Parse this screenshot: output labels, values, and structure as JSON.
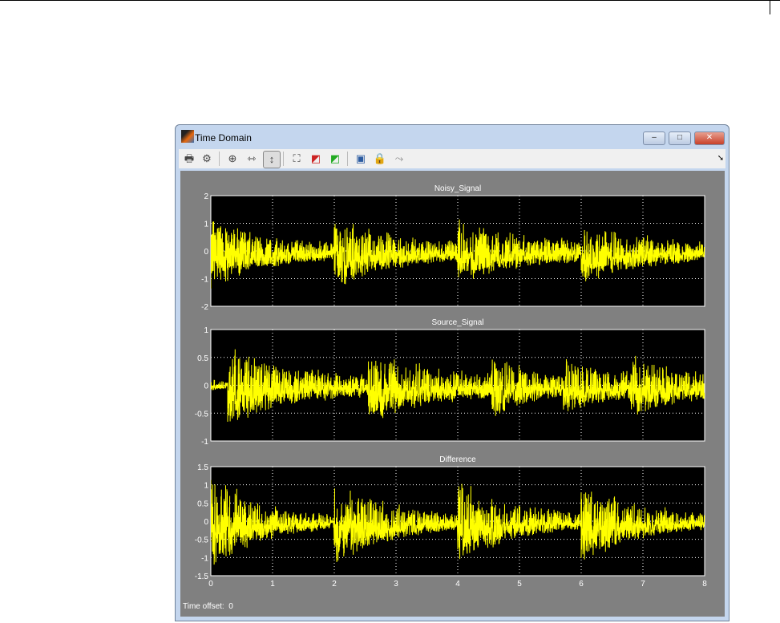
{
  "window": {
    "title": "Time Domain",
    "minimize": "–",
    "maximize": "□",
    "close": "✕"
  },
  "toolbar": {
    "icons": [
      "print-icon",
      "parameters-gear-icon",
      "zoom-in-icon",
      "zoom-x-icon",
      "zoom-y-icon",
      "autoscale-icon",
      "save-axes-icon",
      "restore-axes-icon",
      "highlight-block-icon",
      "lock-icon",
      "signal-selector-icon"
    ],
    "arrow": "➘"
  },
  "footer": {
    "time_offset_label": "Time offset:",
    "time_offset_value": "0"
  },
  "colors": {
    "trace": "#ffff00",
    "axes_bg": "#000000",
    "figure_bg": "#808080"
  },
  "chart_data": [
    {
      "type": "line",
      "title": "Noisy_Signal",
      "xlim": [
        0,
        8
      ],
      "ylim": [
        -2,
        2
      ],
      "xticks": [
        "0",
        "1",
        "2",
        "3",
        "4",
        "5",
        "6",
        "7",
        "8"
      ],
      "yticks": [
        "2",
        "1",
        "0",
        "-1",
        "-2"
      ],
      "grid": true,
      "bursts": [
        {
          "start": 0,
          "peak": 1.4,
          "end_amp": 0.4
        },
        {
          "start": 2,
          "peak": 1.4,
          "end_amp": 0.5
        },
        {
          "start": 4,
          "peak": 1.3,
          "end_amp": 0.6
        },
        {
          "start": 6,
          "peak": 1.3,
          "end_amp": 0.5
        }
      ]
    },
    {
      "type": "line",
      "title": "Source_Signal",
      "xlim": [
        0,
        8
      ],
      "ylim": [
        -1,
        1
      ],
      "xticks": [
        "0",
        "1",
        "2",
        "3",
        "4",
        "5",
        "6",
        "7",
        "8"
      ],
      "yticks": [
        "1",
        "0.5",
        "0",
        "-0.5",
        "-1"
      ],
      "grid": true,
      "bursts": [
        {
          "start": 0,
          "peak": 0.15,
          "end_amp": 0.1
        },
        {
          "start": 0.27,
          "peak": 0.8,
          "end_amp": 0.25
        },
        {
          "start": 2.55,
          "peak": 0.75,
          "end_amp": 0.3
        },
        {
          "start": 4.55,
          "peak": 0.7,
          "end_amp": 0.3
        },
        {
          "start": 5.7,
          "peak": 0.65,
          "end_amp": 0.35
        },
        {
          "start": 6.8,
          "peak": 0.65,
          "end_amp": 0.4
        }
      ]
    },
    {
      "type": "line",
      "title": "Difference",
      "xlim": [
        0,
        8
      ],
      "ylim": [
        -1.5,
        1.5
      ],
      "xticks": [
        "0",
        "1",
        "2",
        "3",
        "4",
        "5",
        "6",
        "7",
        "8"
      ],
      "yticks": [
        "1.5",
        "1",
        "0.5",
        "0",
        "-0.5",
        "-1",
        "-1.5"
      ],
      "grid": true,
      "bursts": [
        {
          "start": 0,
          "peak": 1.4,
          "end_amp": 0.15
        },
        {
          "start": 2,
          "peak": 1.4,
          "end_amp": 0.2
        },
        {
          "start": 4,
          "peak": 1.3,
          "end_amp": 0.2
        },
        {
          "start": 6,
          "peak": 1.3,
          "end_amp": 0.2
        }
      ]
    }
  ]
}
